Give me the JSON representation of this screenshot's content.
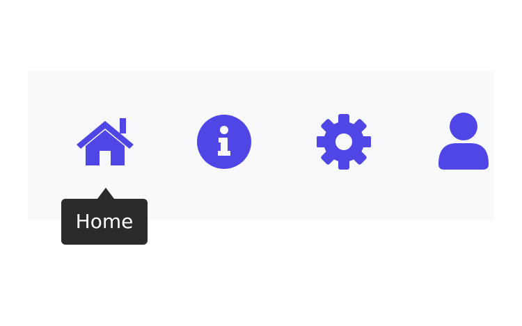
{
  "colors": {
    "accent": "#5046e5",
    "bar_background": "#f8f9fb",
    "tooltip_background": "#2b2b2b",
    "tooltip_text": "#ffffff"
  },
  "nav": {
    "items": [
      {
        "icon": "home-icon"
      },
      {
        "icon": "info-icon"
      },
      {
        "icon": "gear-icon"
      },
      {
        "icon": "user-icon"
      }
    ]
  },
  "tooltip": {
    "text": "Home"
  }
}
